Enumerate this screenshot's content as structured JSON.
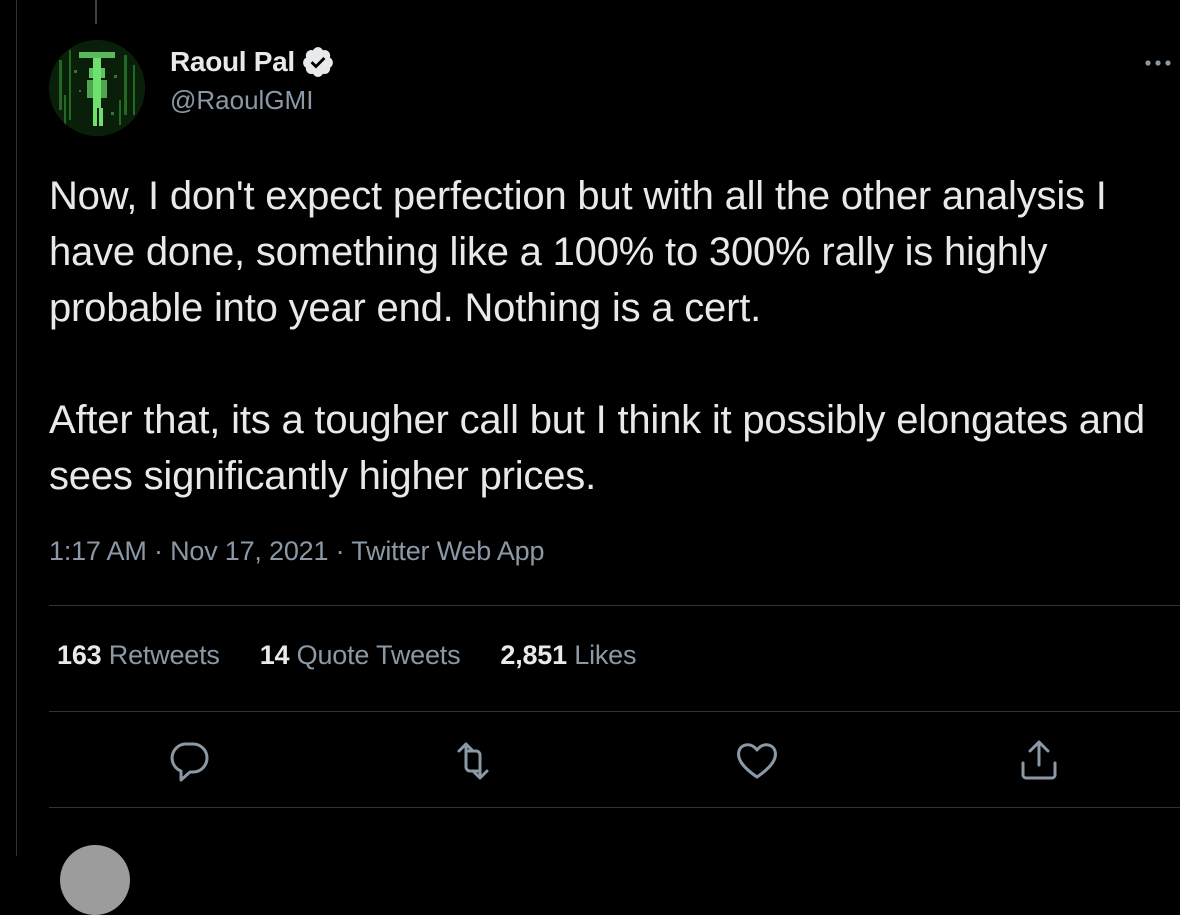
{
  "tweet": {
    "author": {
      "display_name": "Raoul Pal",
      "handle": "@RaoulGMI",
      "verified": true,
      "verified_icon": "verified-badge-icon"
    },
    "text": "Now, I don't expect perfection but with all the other analysis I have done, something like a 100% to 300% rally is highly probable into year end. Nothing is a cert.\n\nAfter that, its a tougher call but I think it possibly elongates and sees significantly higher prices.",
    "time": "1:17 AM",
    "date": "Nov 17, 2021",
    "source": "Twitter Web App",
    "separator": " · ",
    "stats": {
      "retweets": {
        "count": "163",
        "label": "Retweets"
      },
      "quote_tweets": {
        "count": "14",
        "label": "Quote Tweets"
      },
      "likes": {
        "count": "2,851",
        "label": "Likes"
      }
    },
    "actions": [
      "reply-icon",
      "retweet-icon",
      "like-icon",
      "share-icon"
    ]
  },
  "colors": {
    "background": "#000000",
    "primary_text": "#e7e9ea",
    "secondary_text": "#8b98a5",
    "divider": "#2f3336"
  }
}
